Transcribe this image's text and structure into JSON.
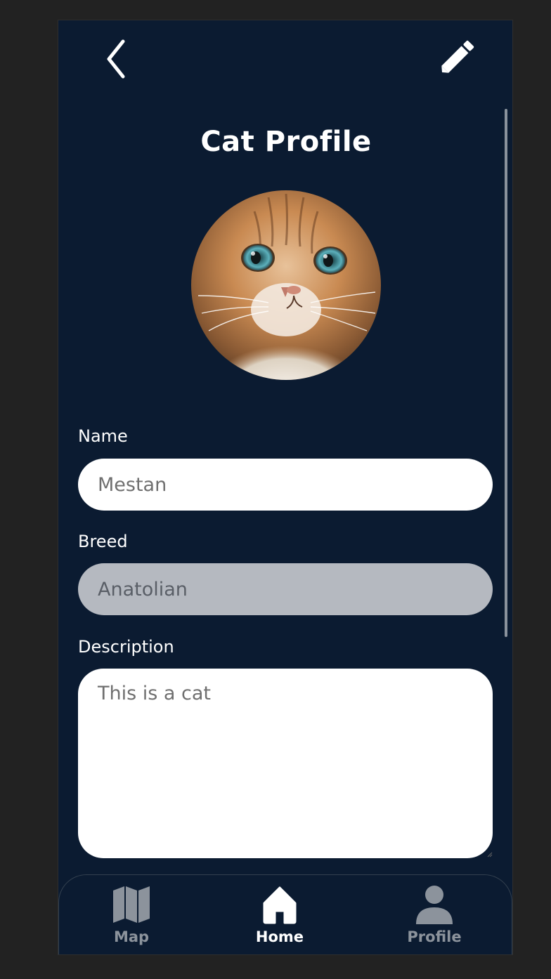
{
  "header": {
    "title": "Cat Profile",
    "back_icon": "chevron-left-icon",
    "edit_icon": "pencil-icon"
  },
  "profile": {
    "avatar_alt": "cat photo"
  },
  "form": {
    "name": {
      "label": "Name",
      "value": "Mestan"
    },
    "breed": {
      "label": "Breed",
      "value": "Anatolian"
    },
    "description": {
      "label": "Description",
      "value": "This is a cat"
    }
  },
  "nav": {
    "items": [
      {
        "label": "Map",
        "icon": "map-icon",
        "active": false
      },
      {
        "label": "Home",
        "icon": "home-icon",
        "active": true
      },
      {
        "label": "Profile",
        "icon": "user-icon",
        "active": false
      }
    ]
  },
  "colors": {
    "background": "#0b1b31",
    "input_bg": "#ffffff",
    "disabled_input_bg": "#b5b9c0",
    "inactive_nav": "#8c939c",
    "active_nav": "#ffffff"
  }
}
